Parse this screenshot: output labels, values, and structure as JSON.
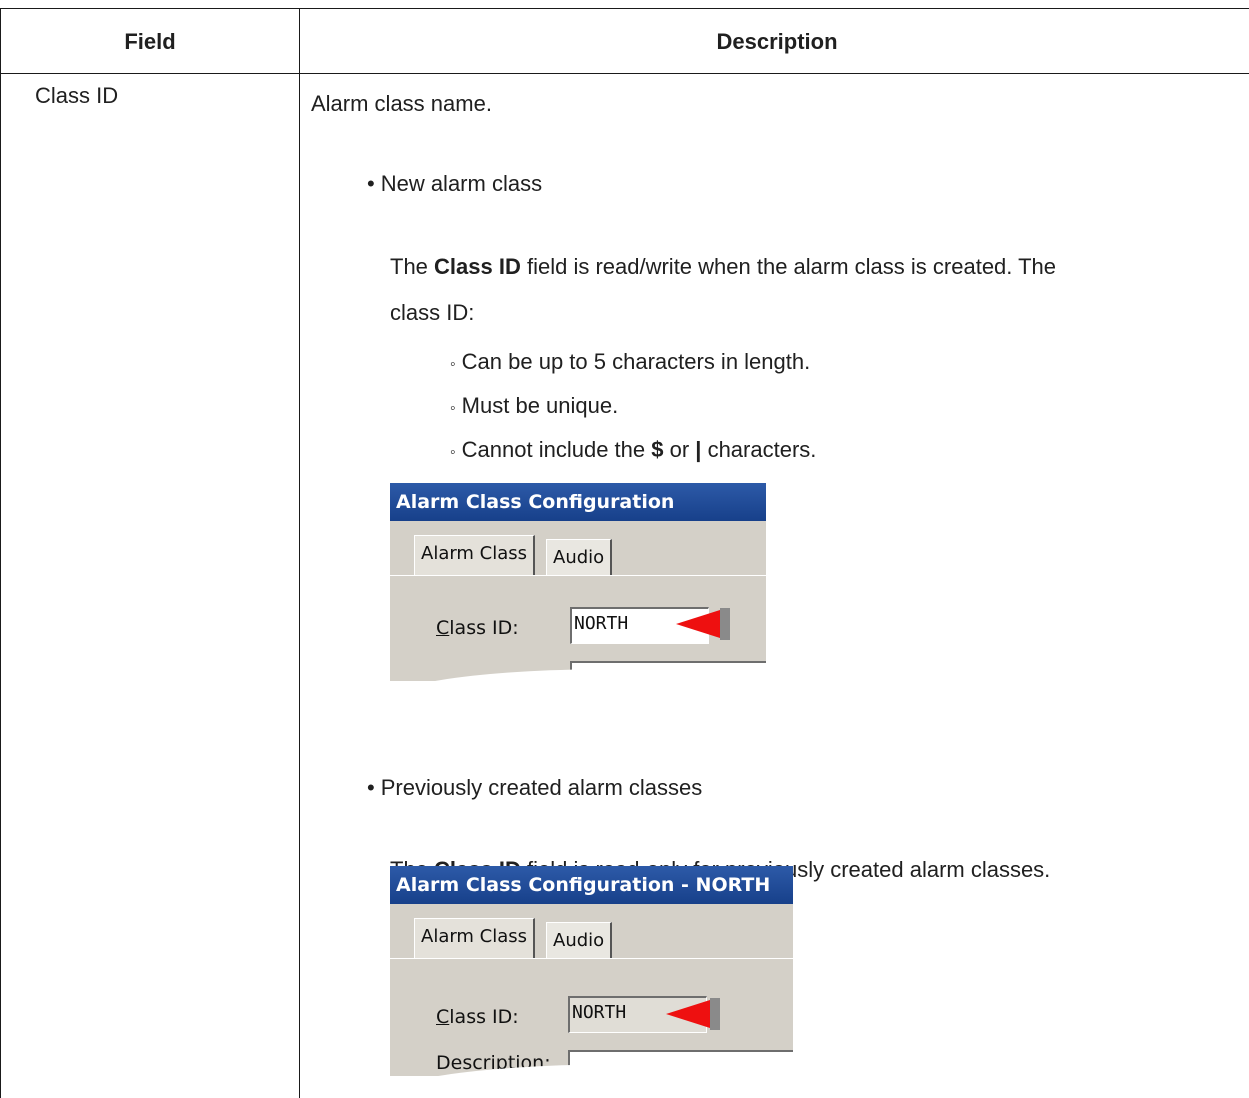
{
  "table": {
    "headers": {
      "field": "Field",
      "description": "Description"
    },
    "row": {
      "field": "Class ID",
      "intro": "Alarm class name.",
      "new_item": {
        "bullet": "•",
        "title": "New alarm class",
        "line1_prefix": "The ",
        "line1_bold": "Class ID",
        "line1_suffix": " field is read/write when the alarm class is created. The",
        "line2": "class ID:",
        "sub_bullet": "◦",
        "rules": [
          "Can be up to 5 characters in length.",
          "Must be unique."
        ],
        "rule3_prefix": "Cannot include the ",
        "rule3_bold1": "$",
        "rule3_mid": " or ",
        "rule3_bold2": "|",
        "rule3_suffix": " characters."
      },
      "prev_item": {
        "bullet": "•",
        "title": "Previously created alarm classes",
        "line1_prefix": "The ",
        "line1_bold": "Class ID",
        "line1_suffix": " field is read-only for previously created alarm classes."
      }
    }
  },
  "screenshots": {
    "new": {
      "window_title": "Alarm Class Configuration",
      "tab_alarm_class": "Alarm Class",
      "tab_audio": "Audio",
      "class_id_label_u": "C",
      "class_id_label_rest": "lass ID:",
      "class_id_value": "NORTH"
    },
    "existing": {
      "window_title": "Alarm Class Configuration - NORTH",
      "tab_alarm_class": "Alarm Class",
      "tab_audio": "Audio",
      "class_id_label_u": "C",
      "class_id_label_rest": "lass ID:",
      "class_id_value": "NORTH",
      "description_label": "Description:"
    }
  },
  "colors": {
    "title_bar": "#17408a",
    "dialog_bg": "#d4d0c8",
    "arrow": "#ee1010"
  }
}
